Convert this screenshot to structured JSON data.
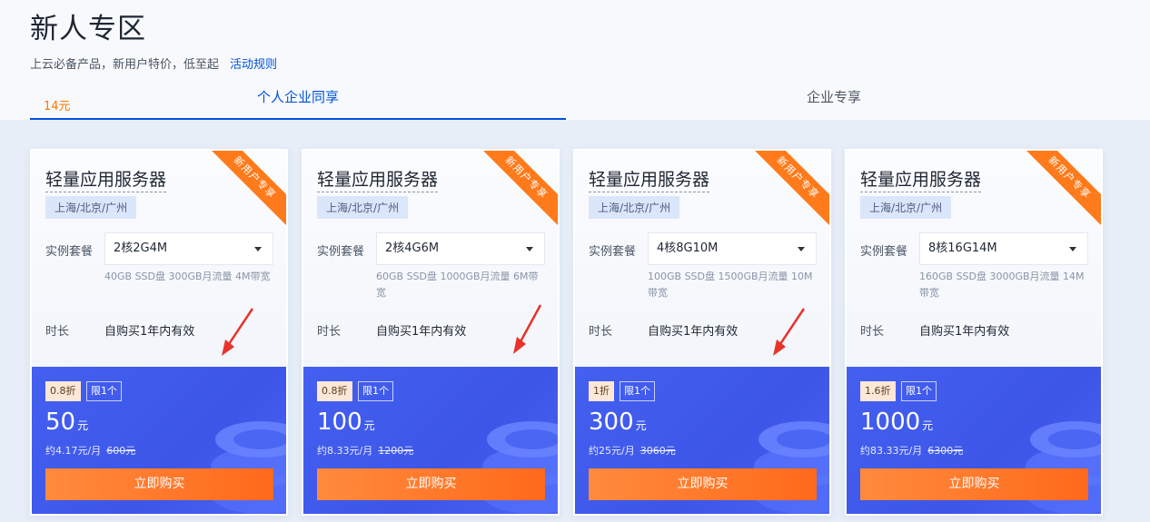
{
  "header": {
    "title": "新人专区",
    "subtitle_prefix": "上云必备产品，新用户特价，低至",
    "subtitle_price": "14元",
    "subtitle_suffix": "起",
    "rules_link": "活动规则"
  },
  "tabs": [
    {
      "label": "个人企业同享",
      "active": true
    },
    {
      "label": "企业专享",
      "active": false
    }
  ],
  "labels": {
    "spec": "实例套餐",
    "duration": "时长",
    "ribbon": "新用户专享",
    "limit": "限1个",
    "price_unit": "元",
    "buy": "立即购买"
  },
  "colors": {
    "accent_blue": "#0052d9",
    "orange": "#ff7a00",
    "card_bottom": "#4460f0",
    "arrow_red": "#e8332b"
  },
  "cards": [
    {
      "name": "轻量应用服务器",
      "region": "上海/北京/广州",
      "spec": "2核2G4M",
      "spec_desc": "40GB SSD盘 300GB月流量 4M带宽",
      "duration": "自购买1年内有效",
      "discount": "0.8折",
      "price": "50",
      "monthly": "约4.17元/月",
      "original": "600元"
    },
    {
      "name": "轻量应用服务器",
      "region": "上海/北京/广州",
      "spec": "2核4G6M",
      "spec_desc": "60GB SSD盘 1000GB月流量 6M带宽",
      "duration": "自购买1年内有效",
      "discount": "0.8折",
      "price": "100",
      "monthly": "约8.33元/月",
      "original": "1200元"
    },
    {
      "name": "轻量应用服务器",
      "region": "上海/北京/广州",
      "spec": "4核8G10M",
      "spec_desc": "100GB SSD盘 1500GB月流量 10M带宽",
      "duration": "自购买1年内有效",
      "discount": "1折",
      "price": "300",
      "monthly": "约25元/月",
      "original": "3060元"
    },
    {
      "name": "轻量应用服务器",
      "region": "上海/北京/广州",
      "spec": "8核16G14M",
      "spec_desc": "160GB SSD盘 3000GB月流量 14M带宽",
      "duration": "自购买1年内有效",
      "discount": "1.6折",
      "price": "1000",
      "monthly": "约83.33元/月",
      "original": "6300元"
    }
  ]
}
